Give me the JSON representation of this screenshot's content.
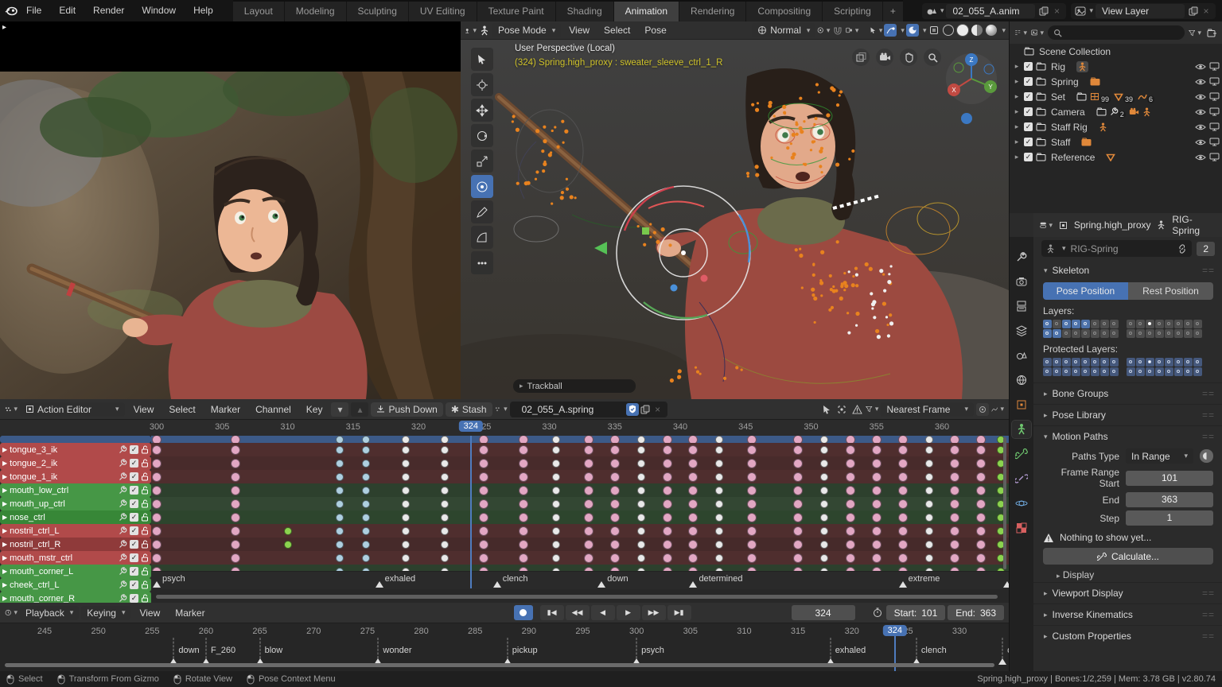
{
  "colors": {
    "accent": "#4772b3",
    "key_pink": "#e2a7c3",
    "key_blue": "#aecfe0",
    "key_white": "#e9e9e9",
    "key_green": "#8bd34f"
  },
  "topbar": {
    "menus": [
      "File",
      "Edit",
      "Render",
      "Window",
      "Help"
    ],
    "tabs": [
      "Layout",
      "Modeling",
      "Sculpting",
      "UV Editing",
      "Texture Paint",
      "Shading",
      "Animation",
      "Rendering",
      "Compositing",
      "Scripting"
    ],
    "active_tab": "Animation",
    "plus_tab": "+",
    "scene": "02_055_A.anim",
    "view_layer": "View Layer"
  },
  "vp3d": {
    "mode": "Pose Mode",
    "menus": [
      "View",
      "Select",
      "Pose"
    ],
    "orientation": "Normal",
    "overlay_line1": "User Perspective (Local)",
    "overlay_line2": "(324) Spring.high_proxy : sweater_sleeve_ctrl_1_R",
    "trackball": "Trackball",
    "axes": {
      "x": "X",
      "y": "Y",
      "z": "Z"
    }
  },
  "outliner": {
    "scene_collection": "Scene Collection",
    "rows": [
      {
        "label": "Rig",
        "tags": [
          {
            "icon": "armature",
            "boxed": true
          }
        ]
      },
      {
        "label": "Spring",
        "tags": [
          {
            "icon": "collection-orange"
          }
        ]
      },
      {
        "label": "Set",
        "tags": [
          {
            "icon": "collection-box"
          },
          {
            "icon": "mesh",
            "badge": "99"
          },
          {
            "icon": "empty",
            "badge": "39"
          },
          {
            "icon": "curve",
            "badge": "6"
          }
        ]
      },
      {
        "label": "Camera",
        "tags": [
          {
            "icon": "collection-box"
          },
          {
            "icon": "wrench",
            "badge": "2"
          },
          {
            "icon": "camera"
          },
          {
            "icon": "armature"
          }
        ]
      },
      {
        "label": "Staff Rig",
        "tags": [
          {
            "icon": "armature"
          }
        ]
      },
      {
        "label": "Staff",
        "tags": [
          {
            "icon": "collection-orange"
          }
        ]
      },
      {
        "label": "Reference",
        "tags": [
          {
            "icon": "empty"
          }
        ]
      }
    ]
  },
  "properties": {
    "breadcrumb": {
      "object": "Spring.high_proxy",
      "data": "RIG-Spring"
    },
    "datablock": {
      "name": "RIG-Spring",
      "users": "2"
    },
    "skeleton": {
      "title": "Skeleton",
      "pose": "Pose Position",
      "rest": "Rest Position",
      "layers_label": "Layers:",
      "protected_label": "Protected Layers:",
      "layers": {
        "left": [
          [
            1,
            0,
            1,
            1,
            1,
            0,
            0,
            0
          ],
          [
            1,
            1,
            0,
            0,
            0,
            0,
            0,
            0
          ]
        ],
        "right": [
          [
            0,
            0,
            2,
            0,
            0,
            0,
            0,
            0
          ],
          [
            0,
            0,
            0,
            0,
            0,
            0,
            0,
            0
          ]
        ]
      },
      "protected": {
        "left": [
          [
            1,
            1,
            1,
            1,
            1,
            1,
            1,
            1
          ],
          [
            1,
            1,
            1,
            1,
            1,
            1,
            1,
            1
          ]
        ],
        "right": [
          [
            1,
            1,
            2,
            1,
            1,
            1,
            1,
            1
          ],
          [
            1,
            1,
            1,
            1,
            1,
            1,
            1,
            1
          ]
        ]
      }
    },
    "panels": {
      "bone_groups": "Bone Groups",
      "pose_library": "Pose Library",
      "motion_paths": "Motion Paths",
      "display": "Display",
      "viewport_display": "Viewport Display",
      "inverse_kinematics": "Inverse Kinematics",
      "custom_properties": "Custom Properties"
    },
    "motion_paths": {
      "paths_type_label": "Paths Type",
      "paths_type_value": "In Range",
      "fields": [
        {
          "label": "Frame Range Start",
          "value": "101"
        },
        {
          "label": "End",
          "value": "363"
        },
        {
          "label": "Step",
          "value": "1"
        }
      ],
      "warning": "Nothing to show yet...",
      "calculate": "Calculate..."
    }
  },
  "dopesheet": {
    "editor_label": "Action Editor",
    "menus": [
      "View",
      "Select",
      "Marker",
      "Channel",
      "Key"
    ],
    "push_down": "Push Down",
    "stash": "Stash",
    "action_name": "02_055_A.spring",
    "snap_label": "Nearest Frame",
    "ruler": {
      "start": 300,
      "end": 360,
      "step": 5,
      "current": 324
    },
    "channels": [
      {
        "name": "tongue_3_ik",
        "color": "#b14a4a",
        "rowbg": "#4f2e2e"
      },
      {
        "name": "tongue_2_ik",
        "color": "#b14a4a",
        "rowbg": "#482b2b"
      },
      {
        "name": "tongue_1_ik",
        "color": "#b14a4a",
        "rowbg": "#4f2e2e"
      },
      {
        "name": "mouth_low_ctrl",
        "color": "#469746",
        "rowbg": "#2d402d"
      },
      {
        "name": "mouth_up_ctrl",
        "color": "#469746",
        "rowbg": "#334733"
      },
      {
        "name": "nose_ctrl",
        "color": "#378737",
        "rowbg": "#2d452d"
      },
      {
        "name": "nostril_ctrl_L",
        "color": "#b14a4a",
        "rowbg": "#4f2e2e"
      },
      {
        "name": "nostril_ctrl_R",
        "color": "#8f3a3a",
        "rowbg": "#462a2a"
      },
      {
        "name": "mouth_mstr_ctrl",
        "color": "#b14a4a",
        "rowbg": "#4f2e2e"
      },
      {
        "name": "mouth_corner_L",
        "color": "#469746",
        "rowbg": "#2d402d"
      },
      {
        "name": "cheek_ctrl_L",
        "color": "#469746",
        "rowbg": "#334733"
      },
      {
        "name": "mouth_corner_R",
        "color": "#469746",
        "rowbg": "#2d402d"
      }
    ],
    "key_columns": [
      {
        "f": 300,
        "c": "pink"
      },
      {
        "f": 306,
        "c": "pink"
      },
      {
        "f": 310,
        "c": "green",
        "only": [
          6,
          7
        ]
      },
      {
        "f": 314,
        "c": "blue"
      },
      {
        "f": 316,
        "c": "blue"
      },
      {
        "f": 319,
        "c": "white"
      },
      {
        "f": 322,
        "c": "white"
      },
      {
        "f": 325,
        "c": "pink"
      },
      {
        "f": 328,
        "c": "pink"
      },
      {
        "f": 330.5,
        "c": "white"
      },
      {
        "f": 333,
        "c": "pink"
      },
      {
        "f": 335,
        "c": "pink"
      },
      {
        "f": 337,
        "c": "white"
      },
      {
        "f": 339,
        "c": "pink"
      },
      {
        "f": 341,
        "c": "pink"
      },
      {
        "f": 343,
        "c": "white"
      },
      {
        "f": 345.5,
        "c": "pink"
      },
      {
        "f": 349,
        "c": "pink"
      },
      {
        "f": 351,
        "c": "white"
      },
      {
        "f": 353,
        "c": "pink"
      },
      {
        "f": 355,
        "c": "pink"
      },
      {
        "f": 357,
        "c": "pink"
      },
      {
        "f": 359,
        "c": "white"
      },
      {
        "f": 361,
        "c": "pink"
      },
      {
        "f": 363,
        "c": "pink"
      },
      {
        "f": 364.5,
        "c": "green"
      }
    ],
    "markers": [
      {
        "f": 300,
        "label": "psych"
      },
      {
        "f": 317,
        "label": "exhaled"
      },
      {
        "f": 326,
        "label": "clench"
      },
      {
        "f": 334,
        "label": "down"
      },
      {
        "f": 341,
        "label": "determined"
      },
      {
        "f": 357,
        "label": "extreme"
      },
      {
        "f": 365,
        "label": "E"
      }
    ]
  },
  "timeline": {
    "menus": [
      "Playback",
      "Keying",
      "View",
      "Marker"
    ],
    "current": "324",
    "start_label": "Start:",
    "start": "101",
    "end_label": "End:",
    "end": "363",
    "ruler": {
      "start": 245,
      "end": 330,
      "step": 5,
      "current": 324
    },
    "markers": [
      {
        "f": 257,
        "label": "down"
      },
      {
        "f": 260,
        "label": "F_260"
      },
      {
        "f": 265,
        "label": "blow"
      },
      {
        "f": 276,
        "label": "wonder"
      },
      {
        "f": 288,
        "label": "pickup"
      },
      {
        "f": 300,
        "label": "psych"
      },
      {
        "f": 318,
        "label": "exhaled"
      },
      {
        "f": 326,
        "label": "clench"
      },
      {
        "f": 334,
        "label": "down"
      }
    ]
  },
  "statusbar": {
    "items": [
      {
        "label": "Select"
      },
      {
        "label": "Transform From Gizmo"
      },
      {
        "label": "Rotate View"
      },
      {
        "label": "Pose Context Menu"
      }
    ],
    "right": "Spring.high_proxy | Bones:1/2,259 | Mem: 3.78 GB | v2.80.74"
  }
}
